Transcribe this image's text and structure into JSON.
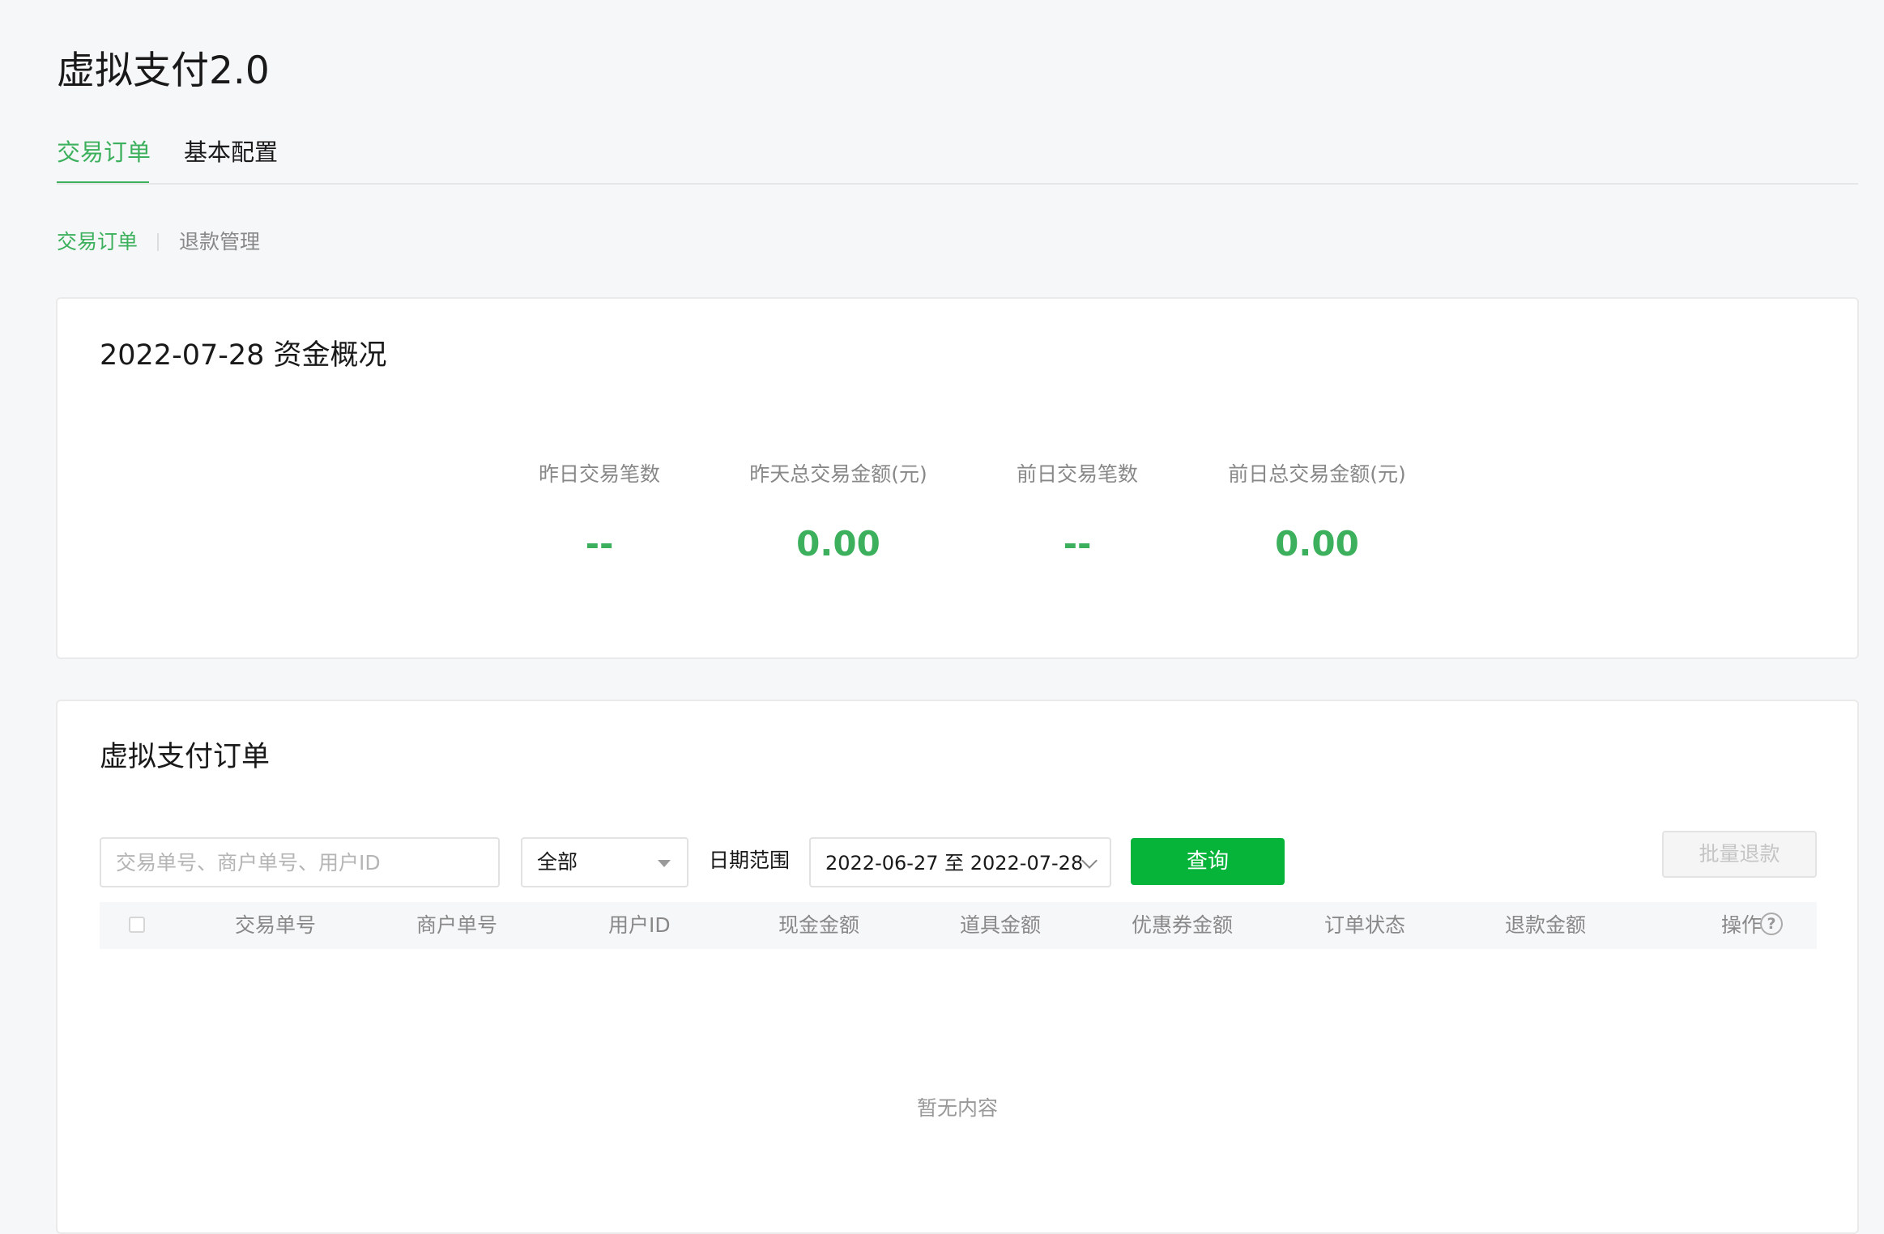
{
  "page": {
    "title": "虚拟支付2.0"
  },
  "tabs": [
    {
      "label": "交易订单"
    },
    {
      "label": "基本配置"
    }
  ],
  "subnav": [
    {
      "label": "交易订单"
    },
    {
      "label": "退款管理"
    }
  ],
  "overview": {
    "title": "2022-07-28 资金概况",
    "stats": [
      {
        "label": "昨日交易笔数",
        "value": "--"
      },
      {
        "label": "昨天总交易金额(元)",
        "value": "0.00"
      },
      {
        "label": "前日交易笔数",
        "value": "--"
      },
      {
        "label": "前日总交易金额(元)",
        "value": "0.00"
      }
    ]
  },
  "orders": {
    "title": "虚拟支付订单",
    "search_placeholder": "交易单号、商户单号、用户ID",
    "status_select": "全部",
    "date_label": "日期范围",
    "date_range": "2022-06-27 至 2022-07-28",
    "query_button": "查询",
    "batch_refund_button": "批量退款",
    "columns": [
      "交易单号",
      "商户单号",
      "用户ID",
      "现金金额",
      "道具金额",
      "优惠券金额",
      "订单状态",
      "退款金额",
      "操作"
    ],
    "empty_text": "暂无内容",
    "help_glyph": "?"
  },
  "colors": {
    "accent": "#3cb05c",
    "primary_button": "#07b43a",
    "background": "#f6f7f9"
  }
}
